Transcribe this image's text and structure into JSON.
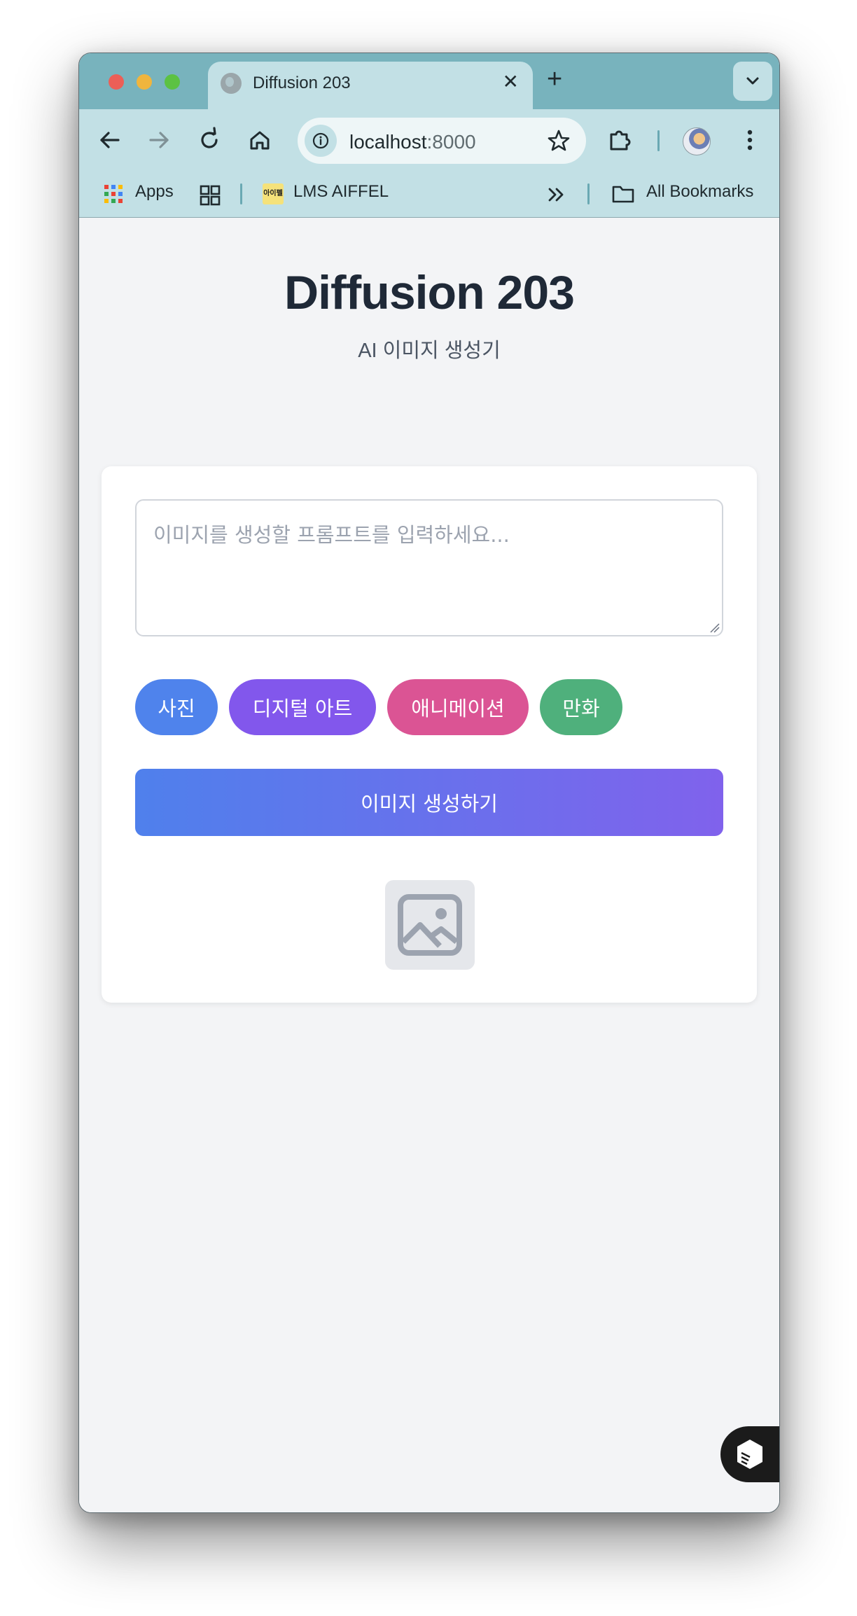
{
  "browser": {
    "tab_title": "Diffusion 203",
    "url_host": "localhost",
    "url_port": ":8000",
    "bookmarks": {
      "apps_label": "Apps",
      "lms_label": "LMS AIFFEL",
      "lms_favicon_text": "아이펠",
      "all_bookmarks_label": "All Bookmarks"
    }
  },
  "page": {
    "title": "Diffusion 203",
    "subtitle": "AI 이미지 생성기",
    "prompt_placeholder": "이미지를 생성할 프롬프트를 입력하세요...",
    "prompt_value": "",
    "style_buttons": [
      {
        "label": "사진",
        "color": "#4f83ec"
      },
      {
        "label": "디지털 아트",
        "color": "#8257ec"
      },
      {
        "label": "애니메이션",
        "color": "#db5494"
      },
      {
        "label": "만화",
        "color": "#4fb07c"
      }
    ],
    "generate_label": "이미지 생성하기",
    "image_placeholder_icon": "image-icon"
  },
  "colors": {
    "tab_strip": "#78b3bd",
    "toolbar": "#c2e0e5",
    "page_bg": "#f3f4f6",
    "title": "#1f2937",
    "generate_gradient_start": "#4f80ec",
    "generate_gradient_end": "#8062ec"
  }
}
